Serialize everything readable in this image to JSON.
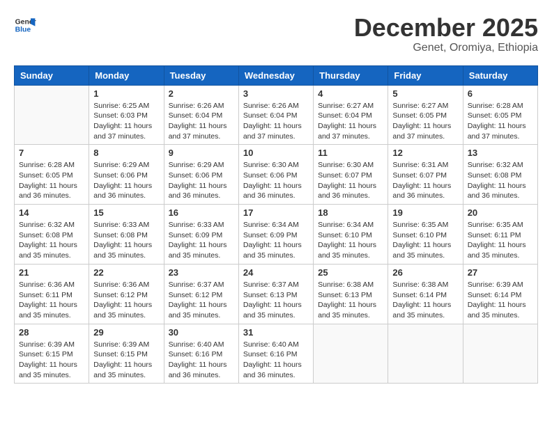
{
  "header": {
    "logo_line1": "General",
    "logo_line2": "Blue",
    "month": "December 2025",
    "location": "Genet, Oromiya, Ethiopia"
  },
  "weekdays": [
    "Sunday",
    "Monday",
    "Tuesday",
    "Wednesday",
    "Thursday",
    "Friday",
    "Saturday"
  ],
  "weeks": [
    [
      {
        "day": "",
        "info": ""
      },
      {
        "day": "1",
        "info": "Sunrise: 6:25 AM\nSunset: 6:03 PM\nDaylight: 11 hours\nand 37 minutes."
      },
      {
        "day": "2",
        "info": "Sunrise: 6:26 AM\nSunset: 6:04 PM\nDaylight: 11 hours\nand 37 minutes."
      },
      {
        "day": "3",
        "info": "Sunrise: 6:26 AM\nSunset: 6:04 PM\nDaylight: 11 hours\nand 37 minutes."
      },
      {
        "day": "4",
        "info": "Sunrise: 6:27 AM\nSunset: 6:04 PM\nDaylight: 11 hours\nand 37 minutes."
      },
      {
        "day": "5",
        "info": "Sunrise: 6:27 AM\nSunset: 6:05 PM\nDaylight: 11 hours\nand 37 minutes."
      },
      {
        "day": "6",
        "info": "Sunrise: 6:28 AM\nSunset: 6:05 PM\nDaylight: 11 hours\nand 37 minutes."
      }
    ],
    [
      {
        "day": "7",
        "info": "Sunrise: 6:28 AM\nSunset: 6:05 PM\nDaylight: 11 hours\nand 36 minutes."
      },
      {
        "day": "8",
        "info": "Sunrise: 6:29 AM\nSunset: 6:06 PM\nDaylight: 11 hours\nand 36 minutes."
      },
      {
        "day": "9",
        "info": "Sunrise: 6:29 AM\nSunset: 6:06 PM\nDaylight: 11 hours\nand 36 minutes."
      },
      {
        "day": "10",
        "info": "Sunrise: 6:30 AM\nSunset: 6:06 PM\nDaylight: 11 hours\nand 36 minutes."
      },
      {
        "day": "11",
        "info": "Sunrise: 6:30 AM\nSunset: 6:07 PM\nDaylight: 11 hours\nand 36 minutes."
      },
      {
        "day": "12",
        "info": "Sunrise: 6:31 AM\nSunset: 6:07 PM\nDaylight: 11 hours\nand 36 minutes."
      },
      {
        "day": "13",
        "info": "Sunrise: 6:32 AM\nSunset: 6:08 PM\nDaylight: 11 hours\nand 36 minutes."
      }
    ],
    [
      {
        "day": "14",
        "info": "Sunrise: 6:32 AM\nSunset: 6:08 PM\nDaylight: 11 hours\nand 35 minutes."
      },
      {
        "day": "15",
        "info": "Sunrise: 6:33 AM\nSunset: 6:08 PM\nDaylight: 11 hours\nand 35 minutes."
      },
      {
        "day": "16",
        "info": "Sunrise: 6:33 AM\nSunset: 6:09 PM\nDaylight: 11 hours\nand 35 minutes."
      },
      {
        "day": "17",
        "info": "Sunrise: 6:34 AM\nSunset: 6:09 PM\nDaylight: 11 hours\nand 35 minutes."
      },
      {
        "day": "18",
        "info": "Sunrise: 6:34 AM\nSunset: 6:10 PM\nDaylight: 11 hours\nand 35 minutes."
      },
      {
        "day": "19",
        "info": "Sunrise: 6:35 AM\nSunset: 6:10 PM\nDaylight: 11 hours\nand 35 minutes."
      },
      {
        "day": "20",
        "info": "Sunrise: 6:35 AM\nSunset: 6:11 PM\nDaylight: 11 hours\nand 35 minutes."
      }
    ],
    [
      {
        "day": "21",
        "info": "Sunrise: 6:36 AM\nSunset: 6:11 PM\nDaylight: 11 hours\nand 35 minutes."
      },
      {
        "day": "22",
        "info": "Sunrise: 6:36 AM\nSunset: 6:12 PM\nDaylight: 11 hours\nand 35 minutes."
      },
      {
        "day": "23",
        "info": "Sunrise: 6:37 AM\nSunset: 6:12 PM\nDaylight: 11 hours\nand 35 minutes."
      },
      {
        "day": "24",
        "info": "Sunrise: 6:37 AM\nSunset: 6:13 PM\nDaylight: 11 hours\nand 35 minutes."
      },
      {
        "day": "25",
        "info": "Sunrise: 6:38 AM\nSunset: 6:13 PM\nDaylight: 11 hours\nand 35 minutes."
      },
      {
        "day": "26",
        "info": "Sunrise: 6:38 AM\nSunset: 6:14 PM\nDaylight: 11 hours\nand 35 minutes."
      },
      {
        "day": "27",
        "info": "Sunrise: 6:39 AM\nSunset: 6:14 PM\nDaylight: 11 hours\nand 35 minutes."
      }
    ],
    [
      {
        "day": "28",
        "info": "Sunrise: 6:39 AM\nSunset: 6:15 PM\nDaylight: 11 hours\nand 35 minutes."
      },
      {
        "day": "29",
        "info": "Sunrise: 6:39 AM\nSunset: 6:15 PM\nDaylight: 11 hours\nand 35 minutes."
      },
      {
        "day": "30",
        "info": "Sunrise: 6:40 AM\nSunset: 6:16 PM\nDaylight: 11 hours\nand 36 minutes."
      },
      {
        "day": "31",
        "info": "Sunrise: 6:40 AM\nSunset: 6:16 PM\nDaylight: 11 hours\nand 36 minutes."
      },
      {
        "day": "",
        "info": ""
      },
      {
        "day": "",
        "info": ""
      },
      {
        "day": "",
        "info": ""
      }
    ]
  ]
}
